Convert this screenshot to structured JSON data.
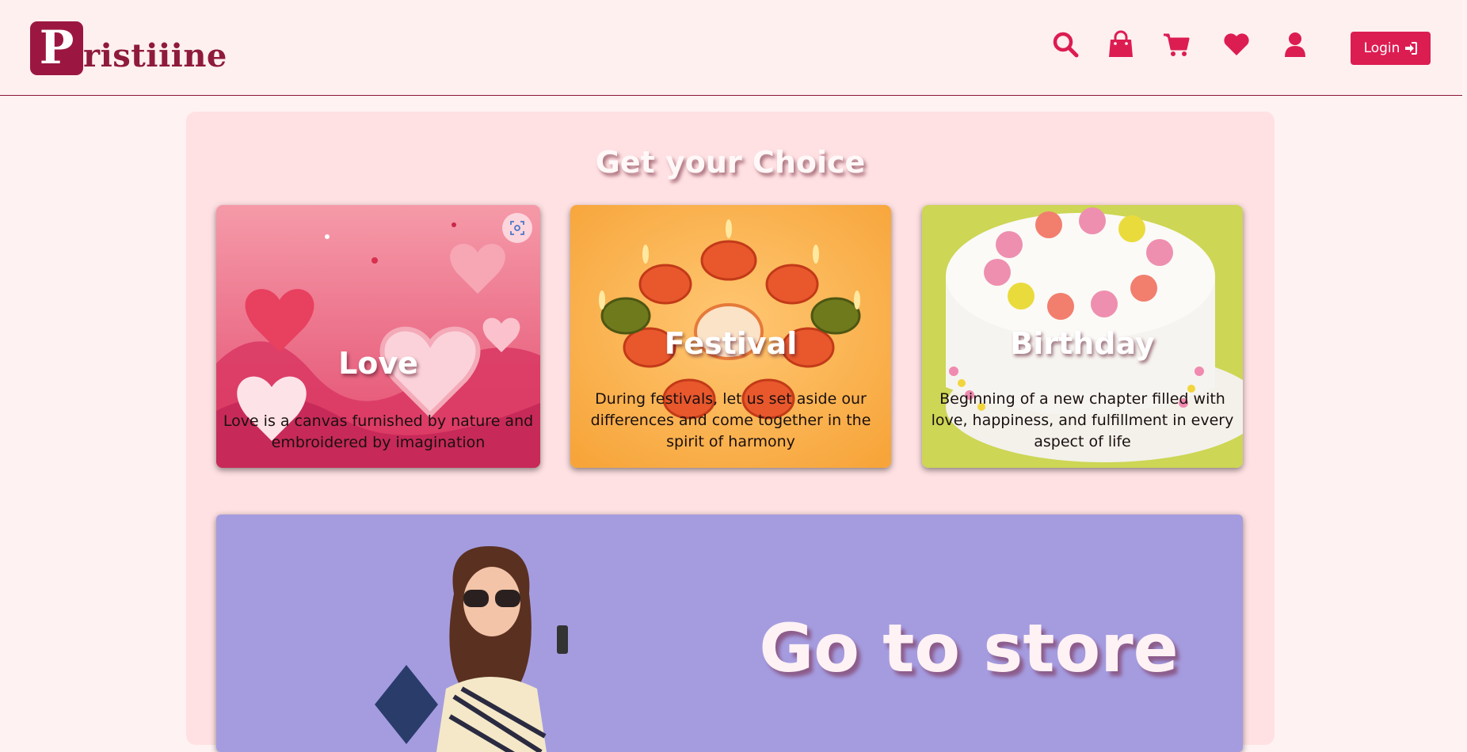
{
  "brand": {
    "logo_letter": "P",
    "logo_rest": "ristiiine"
  },
  "nav": {
    "icons": [
      "search-icon",
      "shopping-bag-icon",
      "cart-icon",
      "heart-icon",
      "user-icon"
    ],
    "login_label": "Login"
  },
  "colors": {
    "accent": "#dc1d52",
    "brand": "#9b1741",
    "panel": "#ffe1e3",
    "background": "#fff2f2",
    "store": "#a59ce0"
  },
  "choices": {
    "title": "Get your Choice",
    "cards": [
      {
        "title": "Love",
        "description": "Love is a canvas furnished by nature and embroidered by imagination"
      },
      {
        "title": "Festival",
        "description": "During festivals, let us set aside our differences and come together in the spirit of harmony"
      },
      {
        "title": "Birthday",
        "description": "Beginning of a new chapter filled with love, happiness, and fulfillment in every aspect of life"
      }
    ]
  },
  "store": {
    "title": "Go to store"
  }
}
